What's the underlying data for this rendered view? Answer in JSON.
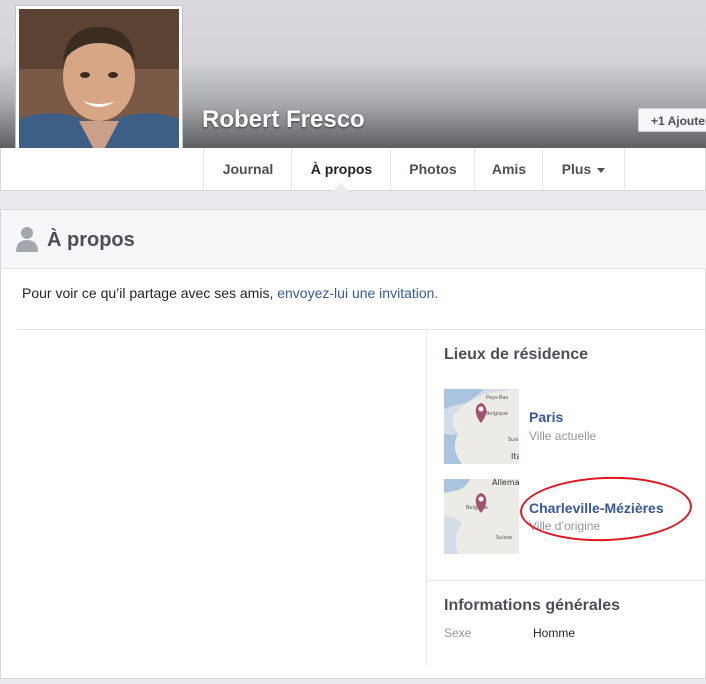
{
  "profile": {
    "name": "Robert Fresco",
    "add_button_label": "Ajouter"
  },
  "nav": {
    "tabs": [
      {
        "label": "Journal"
      },
      {
        "label": "À propos"
      },
      {
        "label": "Photos"
      },
      {
        "label": "Amis"
      },
      {
        "label": "Plus"
      }
    ]
  },
  "about": {
    "title": "À propos",
    "invite_prefix": "Pour voir ce qu’il partage avec ses amis, ",
    "invite_link": "envoyez-lui une invitation.",
    "places": {
      "title": "Lieux de résidence",
      "items": [
        {
          "name": "Paris",
          "type": "Ville actuelle",
          "map_labels": [
            "Pays-Bas",
            "Belgique",
            "Suis",
            "Ita"
          ]
        },
        {
          "name": "Charleville-Mézières",
          "type": "Ville d’origine",
          "map_labels": [
            "Allema",
            "Belgique",
            "Suisse"
          ]
        }
      ]
    },
    "general": {
      "title": "Informations générales",
      "rows": [
        {
          "label": "Sexe",
          "value": "Homme"
        }
      ]
    }
  },
  "colors": {
    "link": "#365899",
    "annotation": "#e0141e"
  }
}
